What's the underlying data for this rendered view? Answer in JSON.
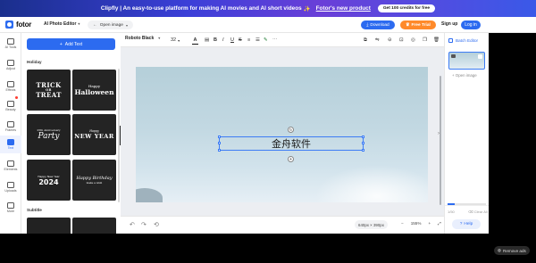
{
  "banner": {
    "text": "Clipfly | An easy-to-use platform for making AI movies and AI short videos",
    "sparkle": "✨",
    "link": "Fotor's new product",
    "cta": "Get 100 credits for free"
  },
  "header": {
    "logo": "fotor",
    "editor_menu": "AI Photo Editor",
    "open_image": "Open image",
    "download": "Download",
    "share_icon": "↗",
    "free_trial": "Free Trial",
    "sign_up": "Sign up",
    "log_in": "Log in"
  },
  "rail": {
    "items": [
      {
        "label": "AI Tools",
        "icon": "sparkle-icon"
      },
      {
        "label": "Adjust",
        "icon": "sliders-icon"
      },
      {
        "label": "Effects",
        "icon": "effects-icon"
      },
      {
        "label": "Beauty",
        "icon": "beauty-icon"
      },
      {
        "label": "Frames",
        "icon": "frame-icon"
      },
      {
        "label": "Text",
        "icon": "text-icon"
      },
      {
        "label": "Elements",
        "icon": "elements-icon"
      },
      {
        "label": "Uploads",
        "icon": "upload-icon"
      },
      {
        "label": "More",
        "icon": "more-icon"
      }
    ]
  },
  "panel": {
    "add_text": "Add Text",
    "section_holiday": "Holiday",
    "section_subtitle": "Subtitle",
    "templates": {
      "trick_line1": "TRICK",
      "trick_or": "OR",
      "trick_line2": "TREAT",
      "halloween_small": "Happy",
      "halloween_big": "Halloween",
      "party_small": "25th Anniversary",
      "party_big": "Party",
      "ny_small": "Happy",
      "ny_big": "NEW YEAR",
      "y2024_small": "Happy New Year",
      "y2024_big": "2024",
      "bday_big": "Happy Birthday",
      "bday_small": "make a wish"
    }
  },
  "toolbar": {
    "font": "Roboto Black",
    "font_size": "32"
  },
  "canvas": {
    "text": "金舟软件"
  },
  "bottom": {
    "canvas_size": "640px × 390px",
    "zoom": "155%"
  },
  "pages": {
    "batch_editor": "Batch Editor",
    "open_image": "Open image",
    "count": "1/50",
    "clear_all": "Clear All",
    "help": "Help"
  },
  "ads": {
    "remove_ads": "Remove ads"
  },
  "colors": {
    "accent": "#2c6bf0",
    "free_trial": "#ff8a2a"
  }
}
